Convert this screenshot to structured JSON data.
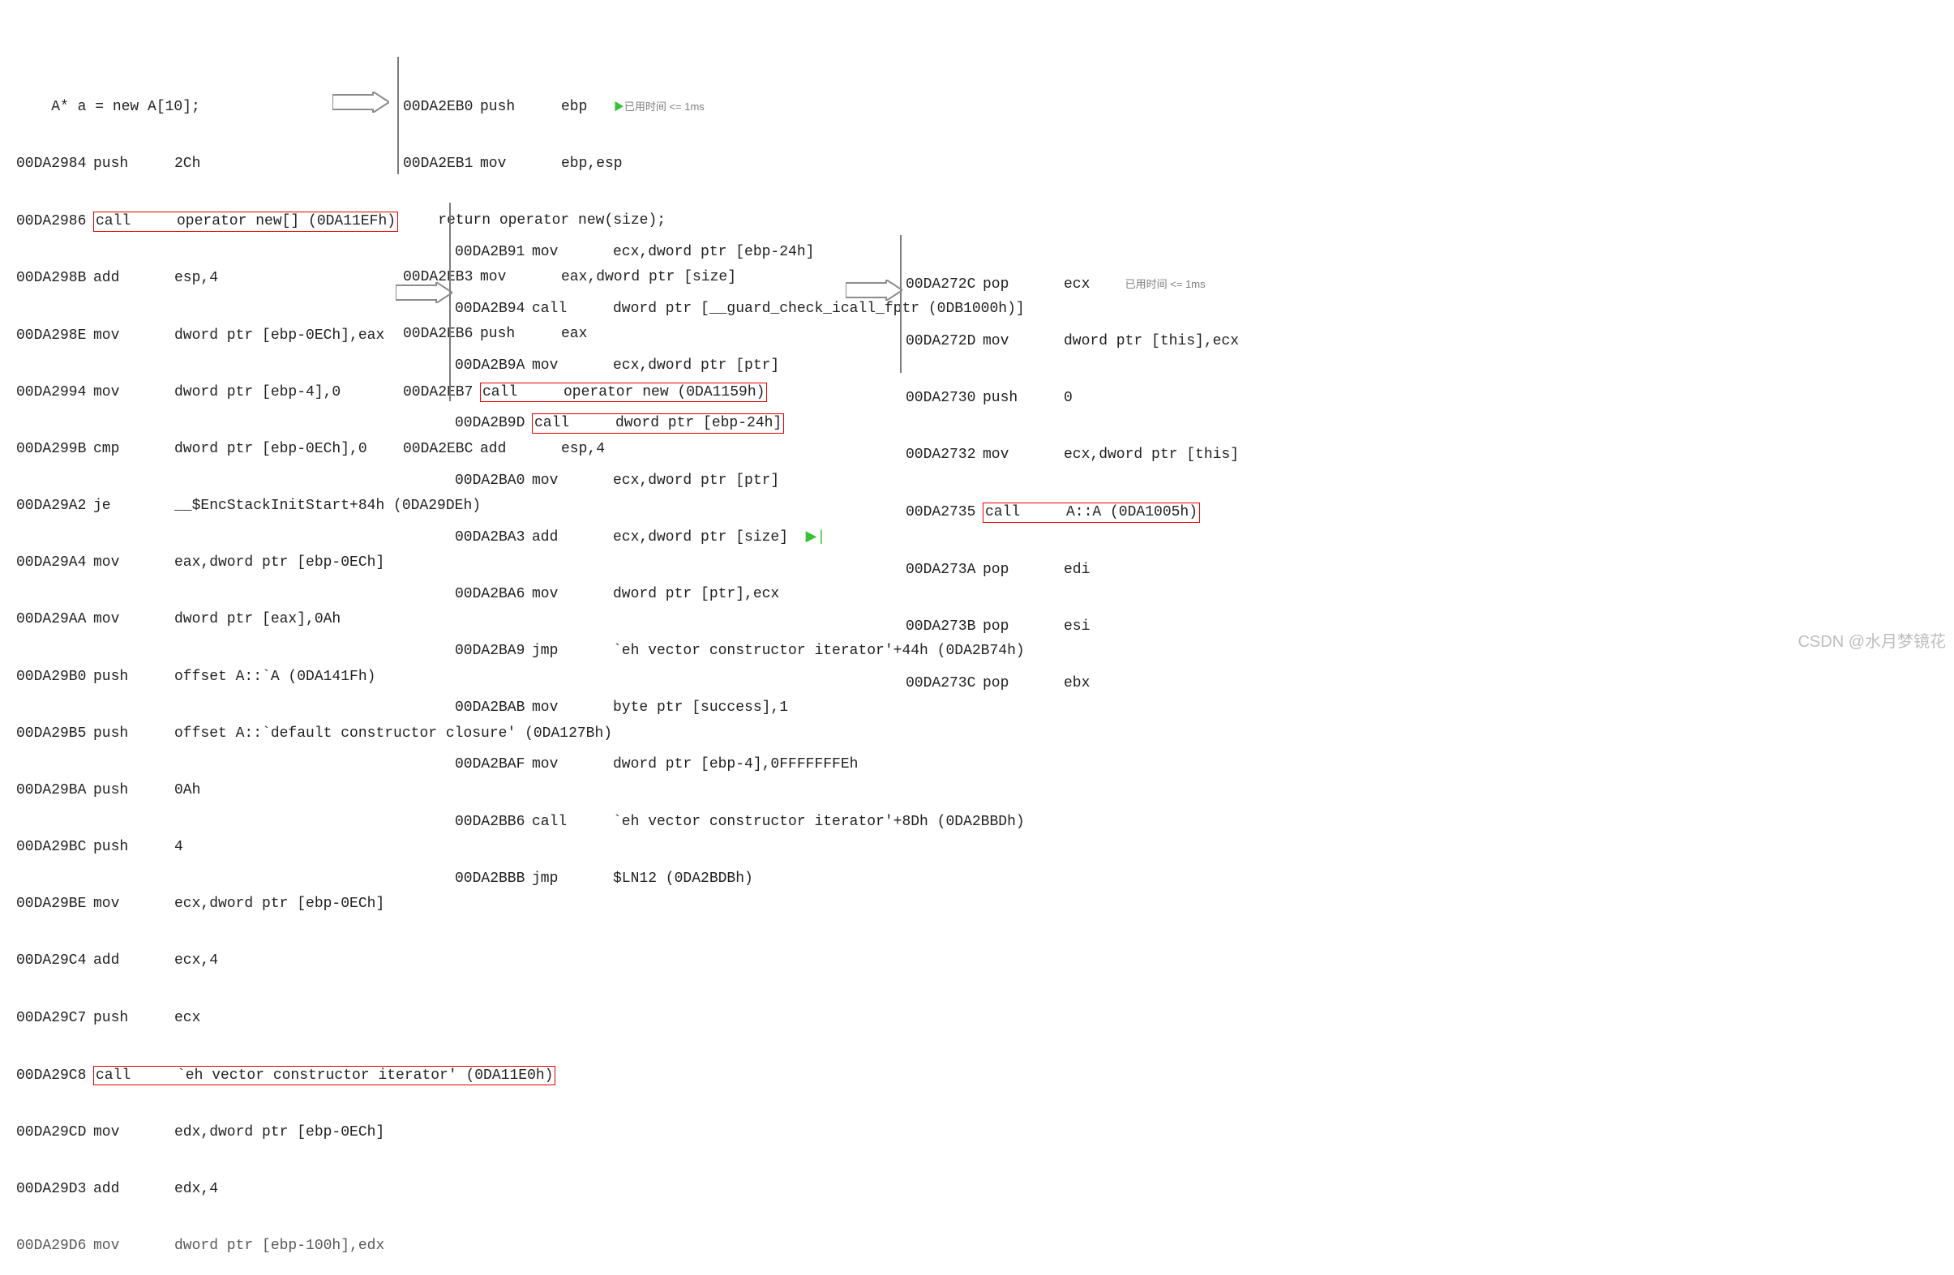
{
  "block1": {
    "srcline": "    A* a = new A[10];",
    "l01": {
      "a": "00DA2984",
      "m": "push",
      "o": "2Ch"
    },
    "l02": {
      "a": "00DA2986",
      "m": "call",
      "o": "operator new[] (0DA11EFh)"
    },
    "l03": {
      "a": "00DA298B",
      "m": "add",
      "o": "esp,4"
    },
    "l04": {
      "a": "00DA298E",
      "m": "mov",
      "o": "dword ptr [ebp-0ECh],eax"
    },
    "l05": {
      "a": "00DA2994",
      "m": "mov",
      "o": "dword ptr [ebp-4],0"
    },
    "l06": {
      "a": "00DA299B",
      "m": "cmp",
      "o": "dword ptr [ebp-0ECh],0"
    },
    "l07": {
      "a": "00DA29A2",
      "m": "je",
      "o": "__$EncStackInitStart+84h (0DA29DEh)"
    },
    "l08": {
      "a": "00DA29A4",
      "m": "mov",
      "o": "eax,dword ptr [ebp-0ECh]"
    },
    "l09": {
      "a": "00DA29AA",
      "m": "mov",
      "o": "dword ptr [eax],0Ah"
    },
    "l10": {
      "a": "00DA29B0",
      "m": "push",
      "o": "offset A::`A (0DA141Fh)"
    },
    "l11": {
      "a": "00DA29B5",
      "m": "push",
      "o": "offset A::`default constructor closure' (0DA127Bh)"
    },
    "l12": {
      "a": "00DA29BA",
      "m": "push",
      "o": "0Ah"
    },
    "l13": {
      "a": "00DA29BC",
      "m": "push",
      "o": "4"
    },
    "l14": {
      "a": "00DA29BE",
      "m": "mov",
      "o": "ecx,dword ptr [ebp-0ECh]"
    },
    "l15": {
      "a": "00DA29C4",
      "m": "add",
      "o": "ecx,4"
    },
    "l16": {
      "a": "00DA29C7",
      "m": "push",
      "o": "ecx"
    },
    "l17": {
      "a": "00DA29C8",
      "m": "call",
      "o": "`eh vector constructor iterator' (0DA11E0h)"
    },
    "l18": {
      "a": "00DA29CD",
      "m": "mov",
      "o": "edx,dword ptr [ebp-0ECh]"
    },
    "l19": {
      "a": "00DA29D3",
      "m": "add",
      "o": "edx,4"
    },
    "l20": {
      "a": "00DA29D6",
      "m": "mov",
      "o": "dword ptr [ebp-100h],edx"
    }
  },
  "block2": {
    "l01": {
      "a": "00DA2EB0",
      "m": "push",
      "o": "ebp"
    },
    "l02": {
      "a": "00DA2EB1",
      "m": "mov",
      "o": "ebp,esp"
    },
    "srcline": "    return operator new(size);",
    "l03": {
      "a": "00DA2EB3",
      "m": "mov",
      "o": "eax,dword ptr [size]"
    },
    "l04": {
      "a": "00DA2EB6",
      "m": "push",
      "o": "eax"
    },
    "l05": {
      "a": "00DA2EB7",
      "m": "call",
      "o": "operator new (0DA1159h)"
    },
    "l06": {
      "a": "00DA2EBC",
      "m": "add",
      "o": "esp,4"
    },
    "hint": "已用时间 <= 1ms"
  },
  "block3": {
    "l01": {
      "a": "00DA2B91",
      "m": "mov",
      "o": "ecx,dword ptr [ebp-24h]"
    },
    "l02": {
      "a": "00DA2B94",
      "m": "call",
      "o": "dword ptr [__guard_check_icall_fptr (0DB1000h)]"
    },
    "l03": {
      "a": "00DA2B9A",
      "m": "mov",
      "o": "ecx,dword ptr [ptr]"
    },
    "l04": {
      "a": "00DA2B9D",
      "m": "call",
      "o": "dword ptr [ebp-24h]"
    },
    "l05": {
      "a": "00DA2BA0",
      "m": "mov",
      "o": "ecx,dword ptr [ptr]"
    },
    "l06": {
      "a": "00DA2BA3",
      "m": "add",
      "o": "ecx,dword ptr [size]"
    },
    "l07": {
      "a": "00DA2BA6",
      "m": "mov",
      "o": "dword ptr [ptr],ecx"
    },
    "l08": {
      "a": "00DA2BA9",
      "m": "jmp",
      "o": "`eh vector constructor iterator'+44h (0DA2B74h)"
    },
    "l09": {
      "a": "00DA2BAB",
      "m": "mov",
      "o": "byte ptr [success],1"
    },
    "l10": {
      "a": "00DA2BAF",
      "m": "mov",
      "o": "dword ptr [ebp-4],0FFFFFFFEh"
    },
    "l11": {
      "a": "00DA2BB6",
      "m": "call",
      "o": "`eh vector constructor iterator'+8Dh (0DA2BBDh)"
    },
    "l12": {
      "a": "00DA2BBB",
      "m": "jmp",
      "o": "$LN12 (0DA2BDBh)"
    }
  },
  "block4": {
    "l01": {
      "a": "00DA272C",
      "m": "pop",
      "o": "ecx"
    },
    "l02": {
      "a": "00DA272D",
      "m": "mov",
      "o": "dword ptr [this],ecx"
    },
    "l03": {
      "a": "00DA2730",
      "m": "push",
      "o": "0"
    },
    "l04": {
      "a": "00DA2732",
      "m": "mov",
      "o": "ecx,dword ptr [this]"
    },
    "l05": {
      "a": "00DA2735",
      "m": "call",
      "o": "A::A (0DA1005h)"
    },
    "l06": {
      "a": "00DA273A",
      "m": "pop",
      "o": "edi"
    },
    "l07": {
      "a": "00DA273B",
      "m": "pop",
      "o": "esi"
    },
    "l08": {
      "a": "00DA273C",
      "m": "pop",
      "o": "ebx"
    },
    "hint": "已用时间 <= 1ms"
  },
  "watermark": "CSDN @水月梦镜花"
}
